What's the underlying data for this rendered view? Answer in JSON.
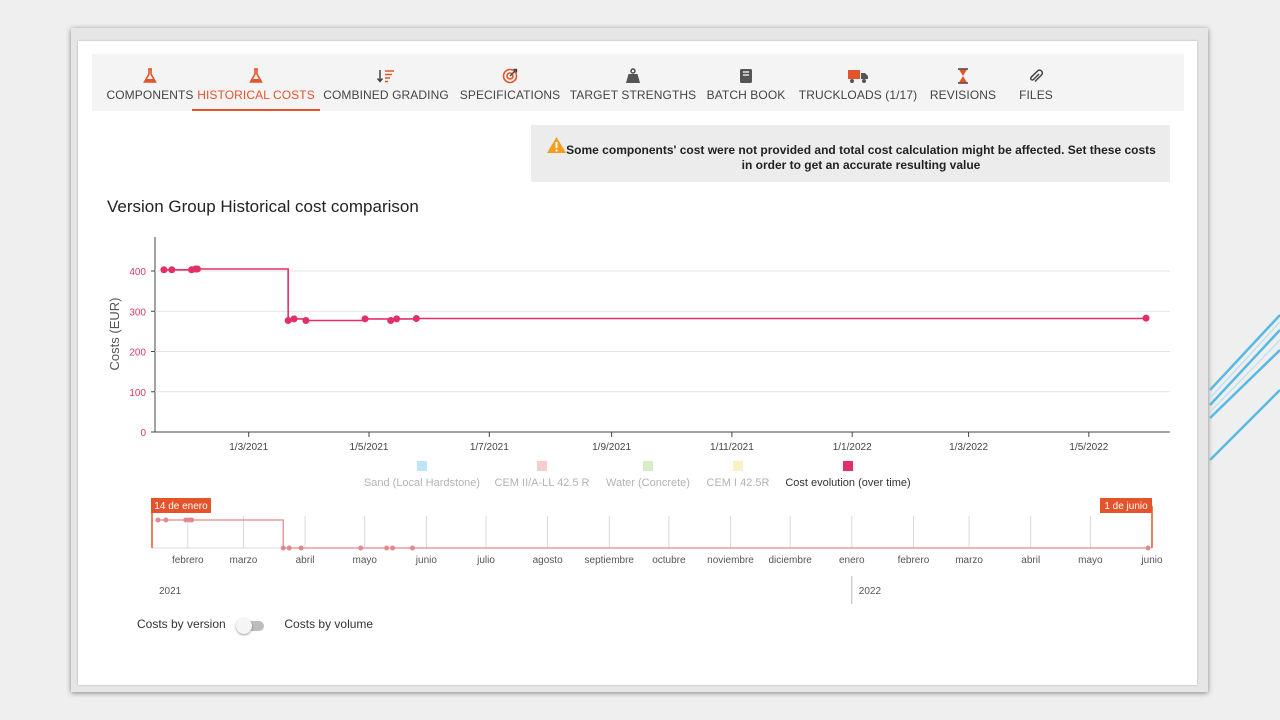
{
  "tabs": [
    {
      "label": "COMPONENTS",
      "icon": "flask-icon",
      "active": false
    },
    {
      "label": "HISTORICAL COSTS",
      "icon": "flask-icon",
      "active": true
    },
    {
      "label": "COMBINED GRADING",
      "icon": "sort-icon",
      "active": false
    },
    {
      "label": "SPECIFICATIONS",
      "icon": "target-icon",
      "active": false
    },
    {
      "label": "TARGET STRENGTHS",
      "icon": "weight-icon",
      "active": false
    },
    {
      "label": "BATCH BOOK",
      "icon": "book-icon",
      "active": false
    },
    {
      "label": "TRUCKLOADS (1/17)",
      "icon": "truck-icon",
      "active": false
    },
    {
      "label": "REVISIONS",
      "icon": "hourglass-icon",
      "active": false
    },
    {
      "label": "FILES",
      "icon": "paperclip-icon",
      "active": false
    }
  ],
  "warning": {
    "icon": "warning-icon",
    "text": "Some components' cost were not provided and total cost calculation might be affected. Set these costs in order to get an accurate resulting value"
  },
  "chart_title": "Version Group Historical cost comparison",
  "chart_data": {
    "type": "line",
    "ylabel": "Costs (EUR)",
    "ylim": [
      0,
      480
    ],
    "yticks": [
      0,
      100,
      200,
      300,
      400
    ],
    "xticks": [
      "1/3/2021",
      "1/5/2021",
      "1/7/2021",
      "1/9/2021",
      "1/11/2021",
      "1/1/2022",
      "1/3/2022",
      "1/5/2022"
    ],
    "grid": true,
    "legend_placement": "bottom",
    "legend": [
      {
        "name": "Sand (Local Hardstone)",
        "color": "#bfe3f7",
        "enabled": false
      },
      {
        "name": "CEM II/A-LL 42.5 R",
        "color": "#f6cccc",
        "enabled": false
      },
      {
        "name": "Water (Concrete)",
        "color": "#d6ecc9",
        "enabled": false
      },
      {
        "name": "CEM I 42.5R",
        "color": "#f9f1c3",
        "enabled": false
      },
      {
        "name": "Cost evolution (over time)",
        "color": "#e22f67",
        "enabled": true
      }
    ],
    "series": [
      {
        "name": "Cost evolution (over time)",
        "color": "#e22f67",
        "step": true,
        "points": [
          {
            "x": "2021-01-17",
            "y": 403
          },
          {
            "x": "2021-01-21",
            "y": 403
          },
          {
            "x": "2021-01-31",
            "y": 403
          },
          {
            "x": "2021-02-02",
            "y": 405
          },
          {
            "x": "2021-02-03",
            "y": 405
          },
          {
            "x": "2021-03-21",
            "y": 277
          },
          {
            "x": "2021-03-24",
            "y": 281
          },
          {
            "x": "2021-03-30",
            "y": 277
          },
          {
            "x": "2021-04-29",
            "y": 281
          },
          {
            "x": "2021-05-12",
            "y": 277
          },
          {
            "x": "2021-05-15",
            "y": 281
          },
          {
            "x": "2021-05-25",
            "y": 282
          },
          {
            "x": "2022-05-30",
            "y": 283
          }
        ]
      }
    ]
  },
  "navigator": {
    "start_label": "14 de enero",
    "end_label": "1 de junio",
    "months": [
      "febrero",
      "marzo",
      "abril",
      "mayo",
      "junio",
      "julio",
      "agosto",
      "septiembre",
      "octubre",
      "noviembre",
      "diciembre",
      "enero",
      "febrero",
      "marzo",
      "abril",
      "mayo",
      "junio"
    ],
    "years": [
      "2021",
      "2022"
    ]
  },
  "toggle": {
    "left_label": "Costs by version",
    "right_label": "Costs by volume",
    "value": "version"
  }
}
